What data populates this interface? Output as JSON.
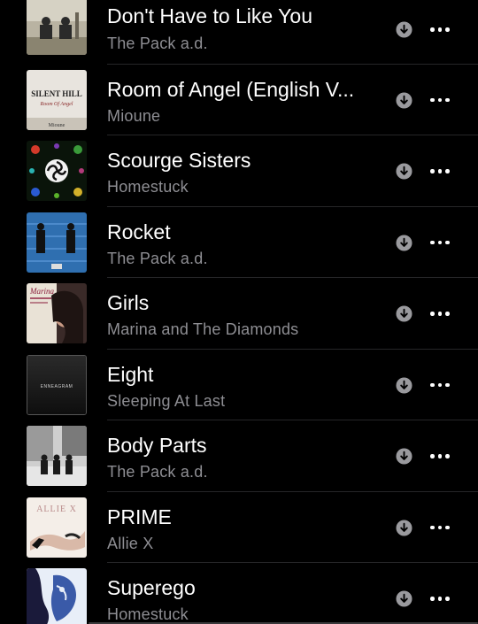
{
  "songs": [
    {
      "title": "Don't Have to Like You",
      "artist": "The Pack a.d.",
      "art": "pack-dont-have-to-like-you-art"
    },
    {
      "title": "Room of Angel (English V...",
      "artist": "Mioune",
      "art": "silent-hill-art"
    },
    {
      "title": "Scourge Sisters",
      "artist": "Homestuck",
      "art": "homestuck-orbs-art"
    },
    {
      "title": "Rocket",
      "artist": "The Pack a.d.",
      "art": "pack-rocket-art"
    },
    {
      "title": "Girls",
      "artist": "Marina and The Diamonds",
      "art": "marina-art"
    },
    {
      "title": "Eight",
      "artist": "Sleeping At Last",
      "art": "enneagram-art"
    },
    {
      "title": "Body Parts",
      "artist": "The Pack a.d.",
      "art": "pack-body-parts-art"
    },
    {
      "title": "PRIME",
      "artist": "Allie X",
      "art": "allie-x-art"
    },
    {
      "title": "Superego",
      "artist": "Homestuck",
      "art": "homestuck-superego-art"
    }
  ],
  "art_text": {
    "silent_hill_title": "SILENT HILL",
    "silent_hill_sub": "Room Of Angel",
    "silent_hill_artist": "Mioune",
    "marina_logo": "Marina",
    "enneagram": "ENNEAGRAM",
    "allie_logo": "ALLIE X"
  },
  "icons": {
    "download": "download-arrow-circle-icon",
    "more": "ellipsis-more-icon"
  },
  "colors": {
    "background": "#000000",
    "title": "#ffffff",
    "subtitle": "#8e8e93",
    "divider": "#262628",
    "download_icon_bg": "#9a9a9e"
  }
}
